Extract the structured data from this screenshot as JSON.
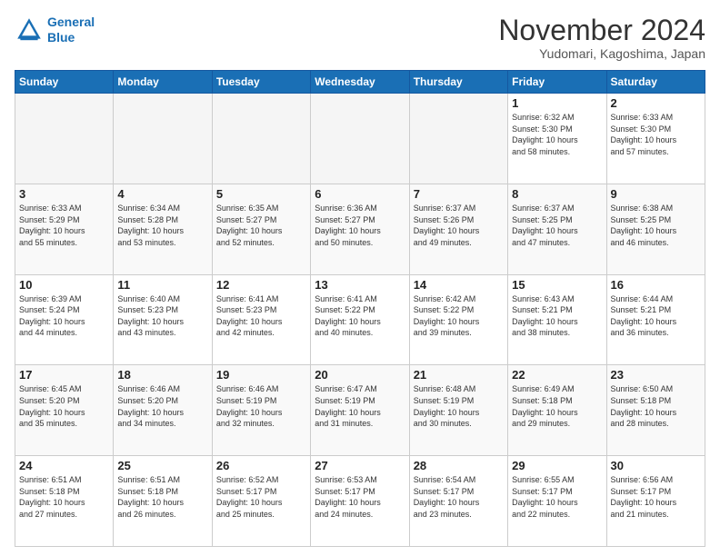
{
  "logo": {
    "line1": "General",
    "line2": "Blue"
  },
  "header": {
    "title": "November 2024",
    "subtitle": "Yudomari, Kagoshima, Japan"
  },
  "weekdays": [
    "Sunday",
    "Monday",
    "Tuesday",
    "Wednesday",
    "Thursday",
    "Friday",
    "Saturday"
  ],
  "weeks": [
    [
      {
        "day": "",
        "info": ""
      },
      {
        "day": "",
        "info": ""
      },
      {
        "day": "",
        "info": ""
      },
      {
        "day": "",
        "info": ""
      },
      {
        "day": "",
        "info": ""
      },
      {
        "day": "1",
        "info": "Sunrise: 6:32 AM\nSunset: 5:30 PM\nDaylight: 10 hours\nand 58 minutes."
      },
      {
        "day": "2",
        "info": "Sunrise: 6:33 AM\nSunset: 5:30 PM\nDaylight: 10 hours\nand 57 minutes."
      }
    ],
    [
      {
        "day": "3",
        "info": "Sunrise: 6:33 AM\nSunset: 5:29 PM\nDaylight: 10 hours\nand 55 minutes."
      },
      {
        "day": "4",
        "info": "Sunrise: 6:34 AM\nSunset: 5:28 PM\nDaylight: 10 hours\nand 53 minutes."
      },
      {
        "day": "5",
        "info": "Sunrise: 6:35 AM\nSunset: 5:27 PM\nDaylight: 10 hours\nand 52 minutes."
      },
      {
        "day": "6",
        "info": "Sunrise: 6:36 AM\nSunset: 5:27 PM\nDaylight: 10 hours\nand 50 minutes."
      },
      {
        "day": "7",
        "info": "Sunrise: 6:37 AM\nSunset: 5:26 PM\nDaylight: 10 hours\nand 49 minutes."
      },
      {
        "day": "8",
        "info": "Sunrise: 6:37 AM\nSunset: 5:25 PM\nDaylight: 10 hours\nand 47 minutes."
      },
      {
        "day": "9",
        "info": "Sunrise: 6:38 AM\nSunset: 5:25 PM\nDaylight: 10 hours\nand 46 minutes."
      }
    ],
    [
      {
        "day": "10",
        "info": "Sunrise: 6:39 AM\nSunset: 5:24 PM\nDaylight: 10 hours\nand 44 minutes."
      },
      {
        "day": "11",
        "info": "Sunrise: 6:40 AM\nSunset: 5:23 PM\nDaylight: 10 hours\nand 43 minutes."
      },
      {
        "day": "12",
        "info": "Sunrise: 6:41 AM\nSunset: 5:23 PM\nDaylight: 10 hours\nand 42 minutes."
      },
      {
        "day": "13",
        "info": "Sunrise: 6:41 AM\nSunset: 5:22 PM\nDaylight: 10 hours\nand 40 minutes."
      },
      {
        "day": "14",
        "info": "Sunrise: 6:42 AM\nSunset: 5:22 PM\nDaylight: 10 hours\nand 39 minutes."
      },
      {
        "day": "15",
        "info": "Sunrise: 6:43 AM\nSunset: 5:21 PM\nDaylight: 10 hours\nand 38 minutes."
      },
      {
        "day": "16",
        "info": "Sunrise: 6:44 AM\nSunset: 5:21 PM\nDaylight: 10 hours\nand 36 minutes."
      }
    ],
    [
      {
        "day": "17",
        "info": "Sunrise: 6:45 AM\nSunset: 5:20 PM\nDaylight: 10 hours\nand 35 minutes."
      },
      {
        "day": "18",
        "info": "Sunrise: 6:46 AM\nSunset: 5:20 PM\nDaylight: 10 hours\nand 34 minutes."
      },
      {
        "day": "19",
        "info": "Sunrise: 6:46 AM\nSunset: 5:19 PM\nDaylight: 10 hours\nand 32 minutes."
      },
      {
        "day": "20",
        "info": "Sunrise: 6:47 AM\nSunset: 5:19 PM\nDaylight: 10 hours\nand 31 minutes."
      },
      {
        "day": "21",
        "info": "Sunrise: 6:48 AM\nSunset: 5:19 PM\nDaylight: 10 hours\nand 30 minutes."
      },
      {
        "day": "22",
        "info": "Sunrise: 6:49 AM\nSunset: 5:18 PM\nDaylight: 10 hours\nand 29 minutes."
      },
      {
        "day": "23",
        "info": "Sunrise: 6:50 AM\nSunset: 5:18 PM\nDaylight: 10 hours\nand 28 minutes."
      }
    ],
    [
      {
        "day": "24",
        "info": "Sunrise: 6:51 AM\nSunset: 5:18 PM\nDaylight: 10 hours\nand 27 minutes."
      },
      {
        "day": "25",
        "info": "Sunrise: 6:51 AM\nSunset: 5:18 PM\nDaylight: 10 hours\nand 26 minutes."
      },
      {
        "day": "26",
        "info": "Sunrise: 6:52 AM\nSunset: 5:17 PM\nDaylight: 10 hours\nand 25 minutes."
      },
      {
        "day": "27",
        "info": "Sunrise: 6:53 AM\nSunset: 5:17 PM\nDaylight: 10 hours\nand 24 minutes."
      },
      {
        "day": "28",
        "info": "Sunrise: 6:54 AM\nSunset: 5:17 PM\nDaylight: 10 hours\nand 23 minutes."
      },
      {
        "day": "29",
        "info": "Sunrise: 6:55 AM\nSunset: 5:17 PM\nDaylight: 10 hours\nand 22 minutes."
      },
      {
        "day": "30",
        "info": "Sunrise: 6:56 AM\nSunset: 5:17 PM\nDaylight: 10 hours\nand 21 minutes."
      }
    ]
  ]
}
